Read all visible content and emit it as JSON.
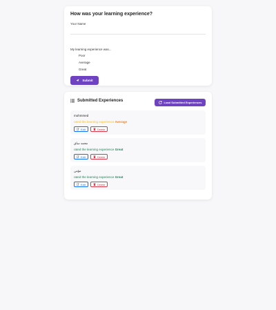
{
  "form": {
    "title": "How was your learning experience?",
    "name_label": "Your Name",
    "name_value": "",
    "experience_label": "My learning experience was...",
    "options": [
      "Poor",
      "Average",
      "Great"
    ],
    "submit_label": "Submit"
  },
  "submitted": {
    "title": "Submitted Experiences",
    "load_label": "Load Submitted Experiences",
    "edit_label": "Edit",
    "delete_label": "Delete",
    "entries": [
      {
        "name": "mohmmed",
        "prefix": "rated the learning experience",
        "rating": "Average"
      },
      {
        "name": "محمد ساق",
        "prefix": "rated the learning experience",
        "rating": "Great"
      },
      {
        "name": "مؤمن",
        "prefix": "rated the learning experience",
        "rating": "Great"
      }
    ]
  },
  "colors": {
    "accent": "#6f42c1",
    "average": "#fd7e14",
    "great": "#198754",
    "edit": "#0d6efd",
    "delete": "#dc3545"
  },
  "icons": {
    "submit": "paper-plane-icon",
    "list": "list-icon",
    "load": "refresh-icon",
    "edit": "edit-icon",
    "delete": "trash-icon"
  }
}
